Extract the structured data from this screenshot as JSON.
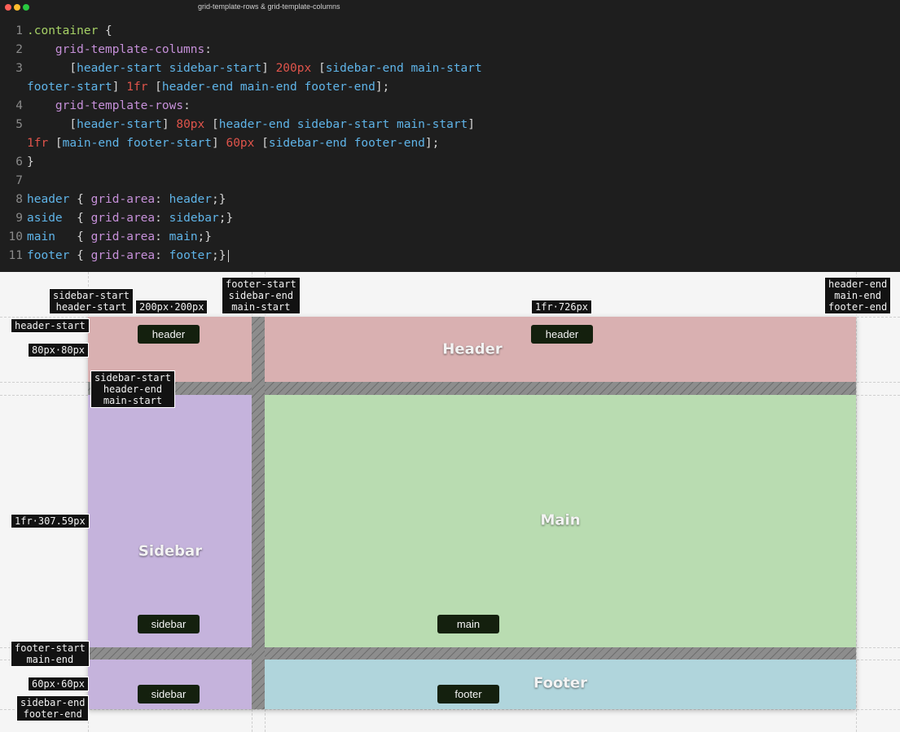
{
  "window": {
    "title": "grid-template-rows & grid-template-columns"
  },
  "editor": {
    "line_numbers": [
      "1",
      "2",
      "3",
      "",
      "4",
      "5",
      "",
      "6",
      "7",
      "8",
      "9",
      "10",
      "11"
    ],
    "lines": [
      [
        {
          "t": ".container",
          "c": "sel"
        },
        {
          "t": " {",
          "c": "punc"
        }
      ],
      [
        {
          "t": "    grid-template-columns",
          "c": "prop"
        },
        {
          "t": ":",
          "c": "punc"
        }
      ],
      [
        {
          "t": "      [",
          "c": "punc"
        },
        {
          "t": "header-start sidebar-start",
          "c": "ident"
        },
        {
          "t": "] ",
          "c": "punc"
        },
        {
          "t": "200px",
          "c": "num"
        },
        {
          "t": " [",
          "c": "punc"
        },
        {
          "t": "sidebar-end main-start",
          "c": "ident"
        }
      ],
      [
        {
          "t": "footer-start",
          "c": "ident"
        },
        {
          "t": "] ",
          "c": "punc"
        },
        {
          "t": "1fr",
          "c": "num"
        },
        {
          "t": " [",
          "c": "punc"
        },
        {
          "t": "header-end main-end footer-end",
          "c": "ident"
        },
        {
          "t": "];",
          "c": "punc"
        }
      ],
      [
        {
          "t": "    grid-template-rows",
          "c": "prop"
        },
        {
          "t": ":",
          "c": "punc"
        }
      ],
      [
        {
          "t": "      [",
          "c": "punc"
        },
        {
          "t": "header-start",
          "c": "ident"
        },
        {
          "t": "] ",
          "c": "punc"
        },
        {
          "t": "80px",
          "c": "num"
        },
        {
          "t": " [",
          "c": "punc"
        },
        {
          "t": "header-end sidebar-start main-start",
          "c": "ident"
        },
        {
          "t": "]",
          "c": "punc"
        }
      ],
      [
        {
          "t": "1fr",
          "c": "num"
        },
        {
          "t": " [",
          "c": "punc"
        },
        {
          "t": "main-end footer-start",
          "c": "ident"
        },
        {
          "t": "] ",
          "c": "punc"
        },
        {
          "t": "60px",
          "c": "num"
        },
        {
          "t": " [",
          "c": "punc"
        },
        {
          "t": "sidebar-end footer-end",
          "c": "ident"
        },
        {
          "t": "];",
          "c": "punc"
        }
      ],
      [
        {
          "t": "}",
          "c": "punc"
        }
      ],
      [],
      [
        {
          "t": "header",
          "c": "ident"
        },
        {
          "t": " { ",
          "c": "punc"
        },
        {
          "t": "grid-area",
          "c": "prop"
        },
        {
          "t": ": ",
          "c": "punc"
        },
        {
          "t": "header",
          "c": "ident"
        },
        {
          "t": ";}",
          "c": "punc"
        }
      ],
      [
        {
          "t": "aside",
          "c": "ident"
        },
        {
          "t": "  { ",
          "c": "punc"
        },
        {
          "t": "grid-area",
          "c": "prop"
        },
        {
          "t": ": ",
          "c": "punc"
        },
        {
          "t": "sidebar",
          "c": "ident"
        },
        {
          "t": ";}",
          "c": "punc"
        }
      ],
      [
        {
          "t": "main",
          "c": "ident"
        },
        {
          "t": "   { ",
          "c": "punc"
        },
        {
          "t": "grid-area",
          "c": "prop"
        },
        {
          "t": ": ",
          "c": "punc"
        },
        {
          "t": "main",
          "c": "ident"
        },
        {
          "t": ";}",
          "c": "punc"
        }
      ],
      [
        {
          "t": "footer",
          "c": "ident"
        },
        {
          "t": " { ",
          "c": "punc"
        },
        {
          "t": "grid-area",
          "c": "prop"
        },
        {
          "t": ": ",
          "c": "punc"
        },
        {
          "t": "footer",
          "c": "ident"
        },
        {
          "t": ";}",
          "c": "punc"
        }
      ]
    ]
  },
  "colors": {
    "header": "#d9b0b1",
    "sidebar": "#c5b3dc",
    "main": "#b9dcb1",
    "footer": "#b0d5dc"
  },
  "areas": {
    "header": "Header",
    "sidebar": "Sidebar",
    "main": "Main",
    "footer": "Footer"
  },
  "pills": {
    "header_1": "header",
    "header_2": "header",
    "sidebar_1": "sidebar",
    "main": "main",
    "sidebar_2": "sidebar",
    "footer": "footer"
  },
  "track_labels": {
    "col_200": "200px·200px",
    "col_1fr": "1fr·726px",
    "row_80": "80px·80px",
    "row_1fr": "1fr·307.59px",
    "row_60": "60px·60px"
  },
  "line_names": {
    "col_start": "sidebar-start\nheader-start",
    "col_mid": "footer-start\nsidebar-end\nmain-start",
    "col_end": "header-end\nmain-end\nfooter-end",
    "row_start": "header-start",
    "row_header_end": "sidebar-start\nheader-end\nmain-start",
    "row_footer_start": "footer-start\nmain-end",
    "row_end": "sidebar-end\nfooter-end"
  }
}
